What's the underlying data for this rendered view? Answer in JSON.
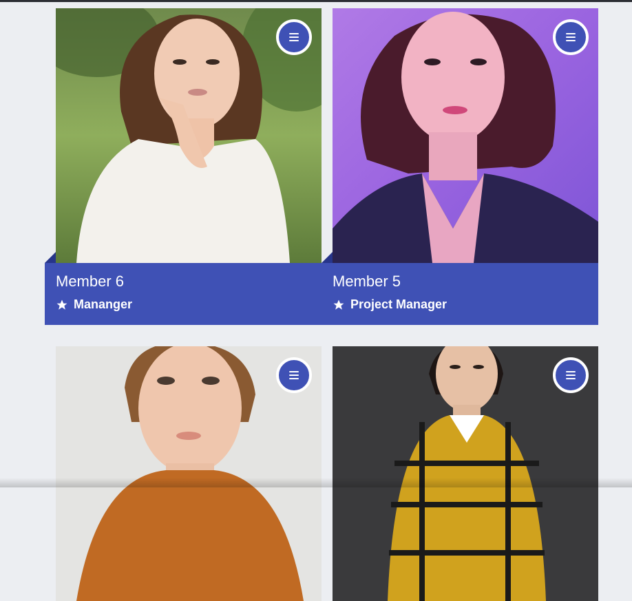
{
  "colors": {
    "accent": "#3f51b5",
    "accent_dark": "#27358a",
    "background": "#eceef2",
    "text_on_accent": "#ffffff"
  },
  "members": [
    {
      "name": "Member 6",
      "role": "Mananger",
      "icon": "star-icon",
      "menu_icon": "menu-icon"
    },
    {
      "name": "Member 5",
      "role": "Project Manager",
      "icon": "star-icon",
      "menu_icon": "menu-icon"
    },
    {
      "name": "",
      "role": "",
      "icon": "star-icon",
      "menu_icon": "menu-icon"
    },
    {
      "name": "",
      "role": "",
      "icon": "star-icon",
      "menu_icon": "menu-icon"
    }
  ]
}
